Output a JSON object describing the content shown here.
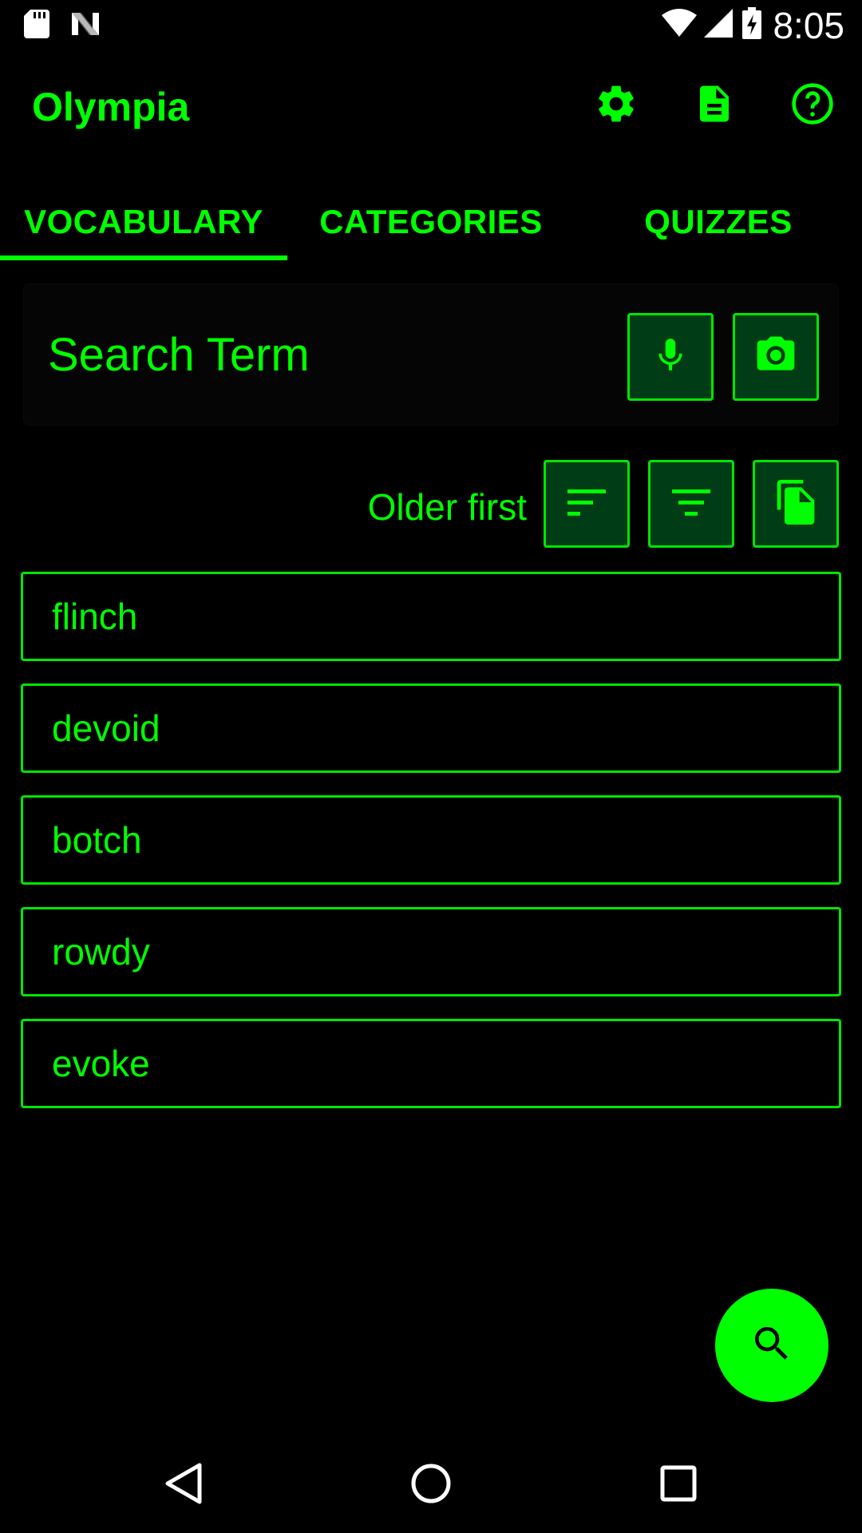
{
  "status_bar": {
    "time": "8:05",
    "left_icons": [
      "sd-card-icon",
      "n-notification-icon"
    ],
    "right_icons": [
      "wifi-icon",
      "cell-signal-icon",
      "battery-charging-icon"
    ]
  },
  "app_bar": {
    "title": "Olympia",
    "actions": [
      "settings-icon",
      "document-icon",
      "help-icon"
    ]
  },
  "tabs": [
    {
      "label": "VOCABULARY",
      "selected": true
    },
    {
      "label": "CATEGORIES",
      "selected": false
    },
    {
      "label": "QUIZZES",
      "selected": false
    }
  ],
  "search": {
    "placeholder": "Search Term",
    "value": "",
    "buttons": [
      "microphone-icon",
      "camera-icon"
    ]
  },
  "sort": {
    "label": "Older first",
    "buttons": [
      "sort-icon",
      "filter-icon",
      "copy-icon"
    ]
  },
  "vocabulary": [
    {
      "term": "flinch"
    },
    {
      "term": "devoid"
    },
    {
      "term": "botch"
    },
    {
      "term": "rowdy"
    },
    {
      "term": "evoke"
    }
  ],
  "fab": {
    "icon": "search-icon"
  },
  "nav_bar": {
    "buttons": [
      "back-icon",
      "home-icon",
      "recents-icon"
    ]
  },
  "colors": {
    "accent": "#00ff00",
    "button_fill": "#003d16",
    "background": "#000000",
    "status_icons": "#ffffff"
  }
}
